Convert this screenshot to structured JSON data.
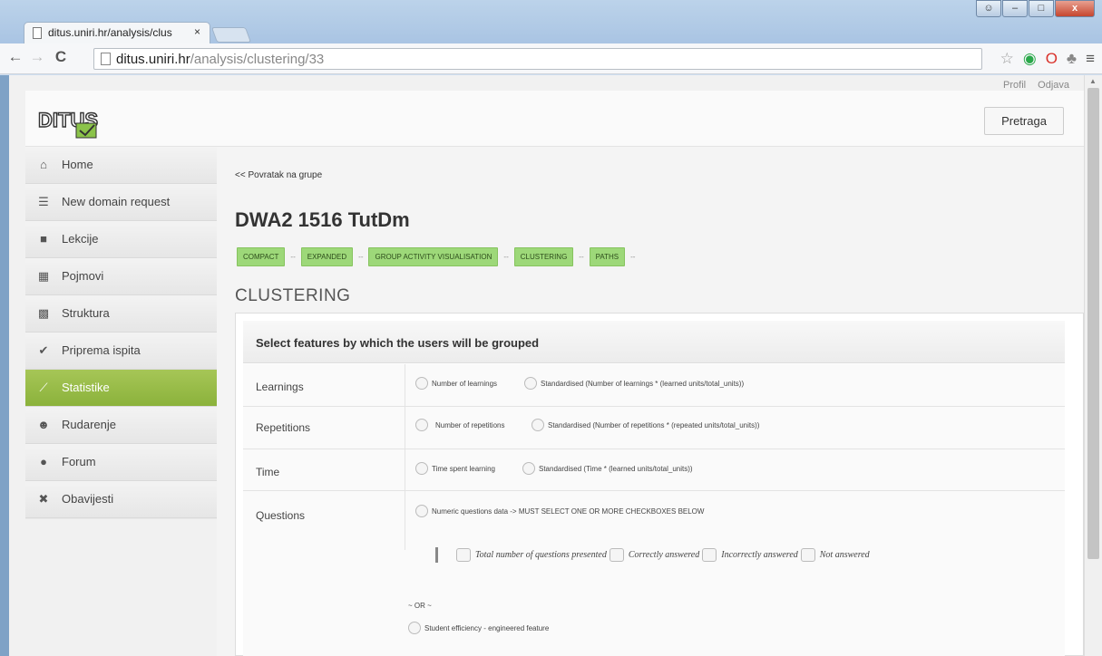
{
  "browser": {
    "tab_title": "ditus.uniri.hr/analysis/clus",
    "tab_close": "×",
    "url_domain": "ditus.uniri.hr",
    "url_path": "/analysis/clustering/33"
  },
  "topnav": {
    "profile": "Profil",
    "logout": "Odjava"
  },
  "header": {
    "search_button": "Pretraga"
  },
  "sidebar": {
    "items": [
      {
        "label": "Home"
      },
      {
        "label": "New domain request"
      },
      {
        "label": "Lekcije"
      },
      {
        "label": "Pojmovi"
      },
      {
        "label": "Struktura"
      },
      {
        "label": "Priprema ispita"
      },
      {
        "label": "Statistike"
      },
      {
        "label": "Rudarenje"
      },
      {
        "label": "Forum"
      },
      {
        "label": "Obavijesti"
      }
    ]
  },
  "main": {
    "back_link": "<< Povratak na grupe",
    "title": "DWA2 1516 TutDm",
    "view_tabs": [
      "COMPACT",
      "EXPANDED",
      "GROUP ACTIVITY VISUALISATION",
      "CLUSTERING",
      "PATHS"
    ],
    "separator": "--",
    "section_title": "CLUSTERING",
    "panel_title": "Select features by which the users will be grouped",
    "rows": [
      {
        "label": "Learnings",
        "opt1": "Number of learnings",
        "opt2": "Standardised (Number of learnings * (learned units/total_units))"
      },
      {
        "label": "Repetitions",
        "opt1": "Number of repetitions",
        "opt2": "Standardised (Number of repetitions * (repeated units/total_units))"
      },
      {
        "label": "Time",
        "opt1": "Time spent learning",
        "opt2": "Standardised (Time * (learned units/total_units))"
      },
      {
        "label": "Questions",
        "opt1": "Numeric questions data -> MUST SELECT ONE OR MORE CHECKBOXES BELOW"
      }
    ],
    "checkboxes": [
      "Total number of questions presented",
      "Correctly answered",
      "Incorrectly answered",
      "Not answered"
    ],
    "or_text": "~ OR ~",
    "engineered": "Student efficiency - engineered feature"
  }
}
